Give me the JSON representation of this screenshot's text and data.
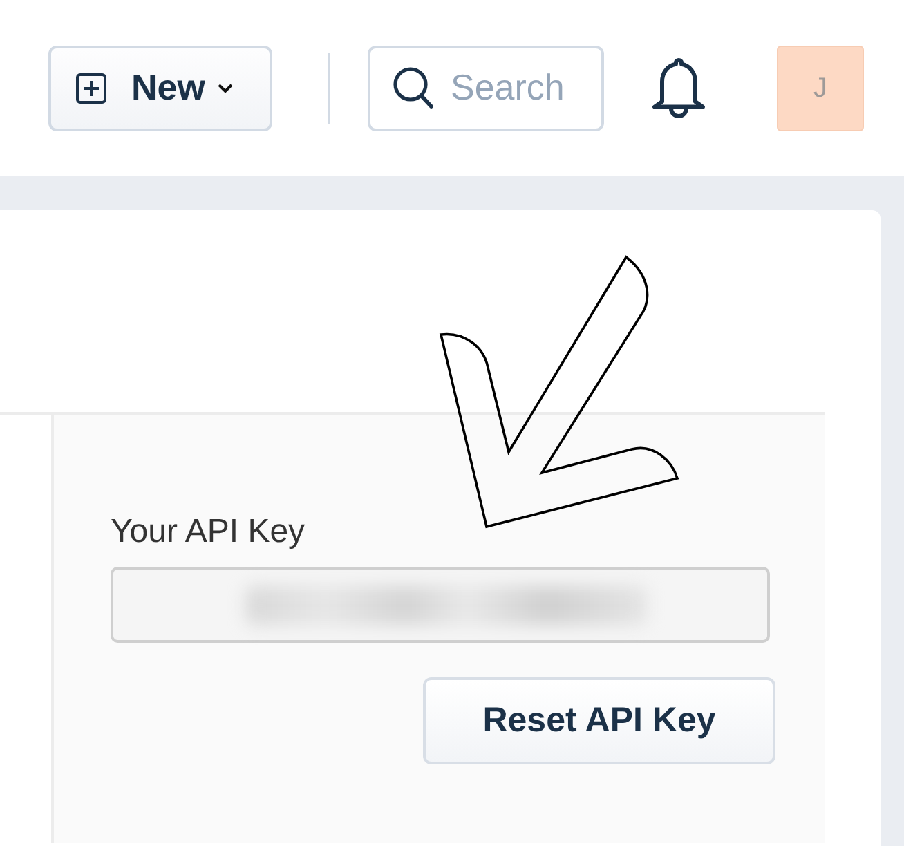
{
  "header": {
    "new_button": {
      "label": "New"
    },
    "search": {
      "placeholder": "Search"
    },
    "avatar": {
      "initial": "J"
    }
  },
  "api_key": {
    "label": "Your API Key",
    "button": "Reset API Key"
  }
}
